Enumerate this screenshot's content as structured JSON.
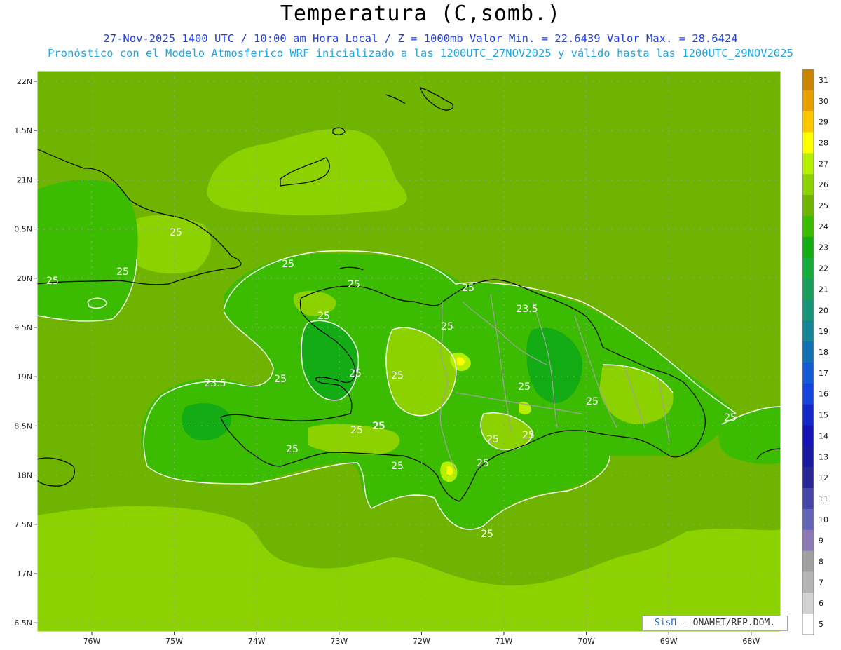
{
  "title": "Temperatura (C,somb.)",
  "subtitle1": "27-Nov-2025 1400 UTC / 10:00 am Hora Local / Z = 1000mb  Valor Min. = 22.6439  Valor Max. = 28.6424",
  "subtitle2": "Pronóstico con el Modelo Atmosferico WRF inicializado a las 1200UTC_27NOV2025 y válido hasta las  1200UTC_29NOV2025",
  "credit": {
    "brand": "SisΠ",
    "text": " - ONAMET/REP.DOM."
  },
  "axes": {
    "lat_labels": [
      "22N",
      "1.5N",
      "21N",
      "0.5N",
      "20N",
      "9.5N",
      "19N",
      "8.5N",
      "18N",
      "7.5N",
      "17N",
      "6.5N"
    ],
    "lon_labels": [
      "76W",
      "75W",
      "74W",
      "73W",
      "72W",
      "71W",
      "70W",
      "69W",
      "68W"
    ]
  },
  "colorbar": {
    "labels": [
      "31",
      "30",
      "29",
      "28",
      "27",
      "26",
      "25",
      "24",
      "23",
      "22",
      "21",
      "20",
      "19",
      "18",
      "17",
      "16",
      "15",
      "14",
      "13",
      "12",
      "11",
      "10",
      "9",
      "8",
      "7",
      "6",
      "5"
    ],
    "colors": [
      "#c88400",
      "#e6a000",
      "#ffc800",
      "#ffff00",
      "#b4f000",
      "#8cd200",
      "#6eb400",
      "#3cbc00",
      "#14ac14",
      "#16ac3c",
      "#1a9c5a",
      "#189478",
      "#168496",
      "#1470b4",
      "#145ad2",
      "#1444dc",
      "#1428c8",
      "#1414b4",
      "#1a1aa0",
      "#282896",
      "#4646a8",
      "#6464b4",
      "#8c78b4",
      "#a0a0a0",
      "#b4b4b4",
      "#d2d2d2",
      "#ffffff"
    ]
  },
  "contour_labels": [
    "25",
    "25",
    "25",
    "25",
    "25",
    "25",
    "23.5",
    "25",
    "25",
    "25",
    "25",
    "25",
    "23.5",
    "25",
    "25",
    "25",
    "25",
    "25",
    "25",
    "25",
    "25",
    "25",
    "25",
    "25",
    "25"
  ],
  "palette": {
    "sea_light": "#8cd200",
    "sea_mid": "#6eb400",
    "land_dark": "#3cbc00",
    "land_darker": "#14ac14",
    "yellow": "#ffff00"
  }
}
